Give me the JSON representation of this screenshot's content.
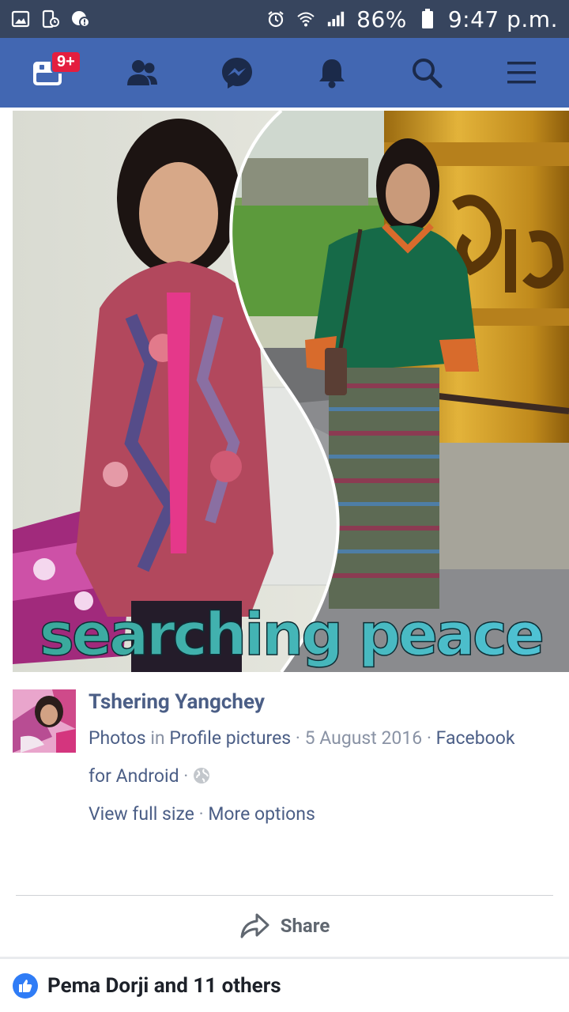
{
  "status_bar": {
    "battery": "86%",
    "time": "9:47 p.m."
  },
  "nav": {
    "notification_badge": "9+"
  },
  "photo": {
    "caption_overlay": "searching peace"
  },
  "post": {
    "author": "Tshering Yangchey",
    "photos_link": "Photos",
    "in_word": "in",
    "album_link": "Profile pictures",
    "date": "5 August 2016",
    "app_link_1": "Facebook",
    "app_link_2": "for Android",
    "view_full_size": "View full size",
    "more_options": "More options"
  },
  "actions": {
    "share_label": "Share"
  },
  "reactions": {
    "likes_text": "Pema Dorji and 11 others"
  },
  "colors": {
    "status_bar": "#37455e",
    "nav_bar": "#4267b2",
    "link": "#4b5e86",
    "like_blue": "#2f7cf6",
    "badge_red": "#e41e3f"
  }
}
